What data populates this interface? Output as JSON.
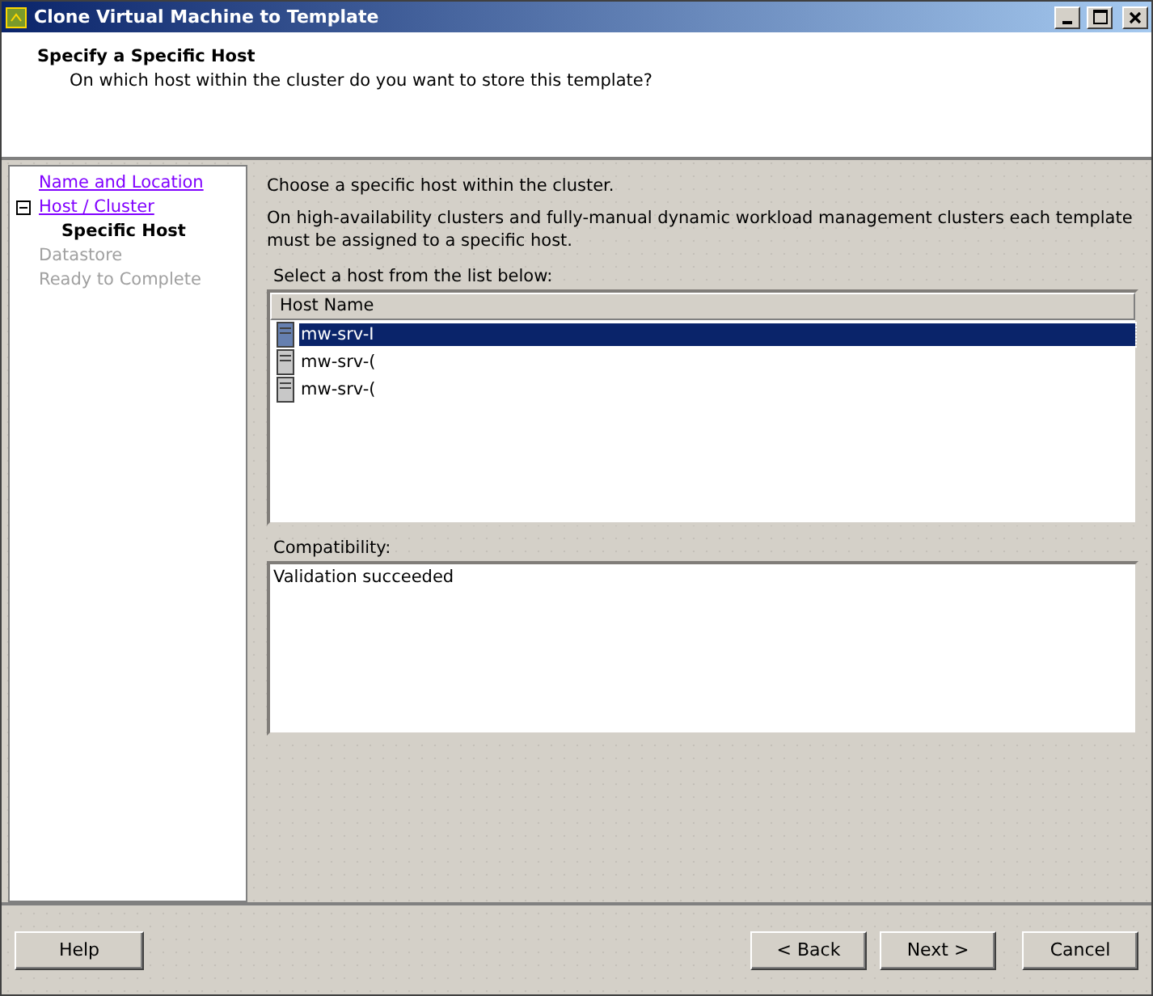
{
  "window": {
    "title": "Clone Virtual Machine to Template"
  },
  "header": {
    "title": "Specify a Specific Host",
    "subtitle": "On which host within the cluster do you want to store this template?"
  },
  "steps": [
    {
      "label": "Name and Location",
      "kind": "link"
    },
    {
      "label": "Host / Cluster",
      "kind": "link",
      "expanded": true,
      "children": [
        {
          "label": "Specific Host",
          "kind": "current"
        }
      ]
    },
    {
      "label": "Datastore",
      "kind": "disabled"
    },
    {
      "label": "Ready to Complete",
      "kind": "disabled"
    }
  ],
  "intro": "Choose a specific host within the cluster.",
  "note": "On high-availability clusters and fully-manual dynamic workload management clusters each template must be assigned to a specific host.",
  "host_list": {
    "label": "Select a host from the list below:",
    "column": "Host Name",
    "rows": [
      {
        "name": "mw-srv-I",
        "selected": true
      },
      {
        "name": "mw-srv-(",
        "selected": false
      },
      {
        "name": "mw-srv-(",
        "selected": false
      }
    ]
  },
  "compatibility": {
    "label": "Compatibility:",
    "text": "Validation succeeded"
  },
  "buttons": {
    "left": [
      "Help"
    ],
    "right": [
      "< Back",
      "Next >",
      "Cancel"
    ]
  }
}
